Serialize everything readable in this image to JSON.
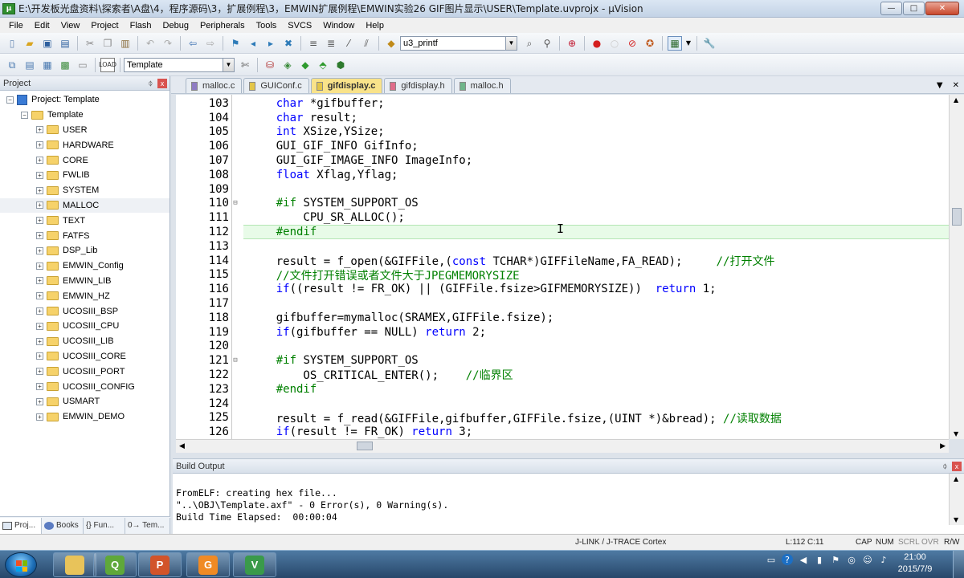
{
  "window": {
    "title": "E:\\开发板光盘资料\\探索者\\A盘\\4，程序源码\\3，扩展例程\\3，EMWIN扩展例程\\EMWIN实验26 GIF图片显示\\USER\\Template.uvprojx - µVision",
    "minimize": "—",
    "maximize": "□",
    "close": "✕"
  },
  "menu": [
    "File",
    "Edit",
    "View",
    "Project",
    "Flash",
    "Debug",
    "Peripherals",
    "Tools",
    "SVCS",
    "Window",
    "Help"
  ],
  "toolbar": {
    "find_combo": "u3_printf",
    "target_combo": "Template"
  },
  "project_panel": {
    "title": "Project",
    "pin": "ᛰ",
    "close": "x",
    "root": "Project: Template",
    "target": "Template",
    "groups": [
      "USER",
      "HARDWARE",
      "CORE",
      "FWLIB",
      "SYSTEM",
      "MALLOC",
      "TEXT",
      "FATFS",
      "DSP_Lib",
      "EMWIN_Config",
      "EMWIN_LIB",
      "EMWIN_HZ",
      "UCOSIII_BSP",
      "UCOSIII_CPU",
      "UCOSIII_LIB",
      "UCOSIII_CORE",
      "UCOSIII_PORT",
      "UCOSIII_CONFIG",
      "USMART",
      "EMWIN_DEMO"
    ],
    "selected_group": "MALLOC",
    "bottom_tabs": [
      "Proj...",
      "Books",
      "{} Fun...",
      "0→ Tem..."
    ]
  },
  "editor": {
    "tabs": [
      {
        "label": "malloc.c",
        "color": "#8e7cc3",
        "active": false
      },
      {
        "label": "GUIConf.c",
        "color": "#e3c64a",
        "active": false
      },
      {
        "label": "gifdisplay.c",
        "color": "#e3c64a",
        "active": true
      },
      {
        "label": "gifdisplay.h",
        "color": "#e06c8a",
        "active": false
      },
      {
        "label": "malloc.h",
        "color": "#6fb58a",
        "active": false
      }
    ],
    "current_line": "112",
    "lines": [
      {
        "n": "103",
        "fold": "",
        "tokens": [
          [
            "    ",
            ""
          ],
          [
            "char",
            "kw"
          ],
          [
            " *gifbuffer;",
            ""
          ]
        ]
      },
      {
        "n": "104",
        "fold": "",
        "tokens": [
          [
            "    ",
            ""
          ],
          [
            "char",
            "kw"
          ],
          [
            " result;",
            ""
          ]
        ]
      },
      {
        "n": "105",
        "fold": "",
        "tokens": [
          [
            "    ",
            ""
          ],
          [
            "int",
            "kw"
          ],
          [
            " XSize,YSize;",
            ""
          ]
        ]
      },
      {
        "n": "106",
        "fold": "",
        "tokens": [
          [
            "    GUI_GIF_INFO GifInfo;",
            ""
          ]
        ]
      },
      {
        "n": "107",
        "fold": "",
        "tokens": [
          [
            "    GUI_GIF_IMAGE_INFO ImageInfo;",
            ""
          ]
        ]
      },
      {
        "n": "108",
        "fold": "",
        "tokens": [
          [
            "    ",
            ""
          ],
          [
            "float",
            "kw"
          ],
          [
            " Xflag,Yflag;",
            ""
          ]
        ]
      },
      {
        "n": "109",
        "fold": "",
        "tokens": [
          [
            "",
            ""
          ]
        ]
      },
      {
        "n": "110",
        "fold": "⊟",
        "tokens": [
          [
            "    ",
            ""
          ],
          [
            "#if",
            "pp"
          ],
          [
            " SYSTEM_SUPPORT_OS",
            ""
          ]
        ]
      },
      {
        "n": "111",
        "fold": "",
        "tokens": [
          [
            "        CPU_SR_ALLOC();",
            ""
          ]
        ]
      },
      {
        "n": "112",
        "fold": "",
        "tokens": [
          [
            "    ",
            ""
          ],
          [
            "#endif",
            "pp"
          ]
        ]
      },
      {
        "n": "113",
        "fold": "",
        "tokens": [
          [
            "",
            ""
          ]
        ]
      },
      {
        "n": "114",
        "fold": "",
        "tokens": [
          [
            "    result = f_open(&GIFFile,(",
            ""
          ],
          [
            "const",
            "kw"
          ],
          [
            " TCHAR*)GIFFileName,FA_READ);     ",
            ""
          ],
          [
            "//打开文件",
            "cm"
          ]
        ]
      },
      {
        "n": "115",
        "fold": "",
        "tokens": [
          [
            "    ",
            ""
          ],
          [
            "//文件打开错误或者文件大于JPEGMEMORYSIZE",
            "cm"
          ]
        ]
      },
      {
        "n": "116",
        "fold": "",
        "tokens": [
          [
            "    ",
            ""
          ],
          [
            "if",
            "kw"
          ],
          [
            "((result != FR_OK) || (GIFFile.fsize>GIFMEMORYSIZE))  ",
            ""
          ],
          [
            "return",
            "kw"
          ],
          [
            " 1;",
            ""
          ]
        ]
      },
      {
        "n": "117",
        "fold": "",
        "tokens": [
          [
            "",
            ""
          ]
        ]
      },
      {
        "n": "118",
        "fold": "",
        "tokens": [
          [
            "    gifbuffer=mymalloc(SRAMEX,GIFFile.fsize);",
            ""
          ]
        ]
      },
      {
        "n": "119",
        "fold": "",
        "tokens": [
          [
            "    ",
            ""
          ],
          [
            "if",
            "kw"
          ],
          [
            "(gifbuffer == NULL) ",
            ""
          ],
          [
            "return",
            "kw"
          ],
          [
            " 2;",
            ""
          ]
        ]
      },
      {
        "n": "120",
        "fold": "",
        "tokens": [
          [
            "",
            ""
          ]
        ]
      },
      {
        "n": "121",
        "fold": "⊟",
        "tokens": [
          [
            "    ",
            ""
          ],
          [
            "#if",
            "pp"
          ],
          [
            " SYSTEM_SUPPORT_OS",
            ""
          ]
        ]
      },
      {
        "n": "122",
        "fold": "",
        "tokens": [
          [
            "        OS_CRITICAL_ENTER();    ",
            ""
          ],
          [
            "//临界区",
            "cm"
          ]
        ]
      },
      {
        "n": "123",
        "fold": "",
        "tokens": [
          [
            "    ",
            ""
          ],
          [
            "#endif",
            "pp"
          ]
        ]
      },
      {
        "n": "124",
        "fold": "",
        "tokens": [
          [
            "",
            ""
          ]
        ]
      },
      {
        "n": "125",
        "fold": "",
        "tokens": [
          [
            "    result = f_read(&GIFFile,gifbuffer,GIFFile.fsize,(UINT *)&bread); ",
            ""
          ],
          [
            "//读取数据",
            "cm"
          ]
        ]
      },
      {
        "n": "126",
        "fold": "",
        "tokens": [
          [
            "    ",
            ""
          ],
          [
            "if",
            "kw"
          ],
          [
            "(result != FR_OK) ",
            ""
          ],
          [
            "return",
            "kw"
          ],
          [
            " 3;",
            ""
          ]
        ]
      }
    ]
  },
  "build_output": {
    "title": "Build Output",
    "lines": [
      "FromELF: creating hex file...",
      "\"..\\OBJ\\Template.axf\" - 0 Error(s), 0 Warning(s).",
      "Build Time Elapsed:  00:00:04"
    ]
  },
  "status_bar": {
    "debugger": "J-LINK / J-TRACE Cortex",
    "position": "L:112 C:11",
    "indicators": [
      "CAP",
      "NUM",
      "SCRL",
      "OVR",
      "R/W"
    ]
  },
  "taskbar": {
    "apps": [
      {
        "name": "explorer",
        "glyph": "",
        "color": "#e8c35a"
      },
      {
        "name": "app-q",
        "glyph": "Q",
        "color": "#5fa83a"
      },
      {
        "name": "powerpoint",
        "glyph": "P",
        "color": "#d2542a"
      },
      {
        "name": "foxit",
        "glyph": "G",
        "color": "#f08a24"
      },
      {
        "name": "uvision",
        "glyph": "V",
        "color": "#3a9a4a"
      }
    ],
    "time": "21:00",
    "date": "2015/7/9"
  }
}
